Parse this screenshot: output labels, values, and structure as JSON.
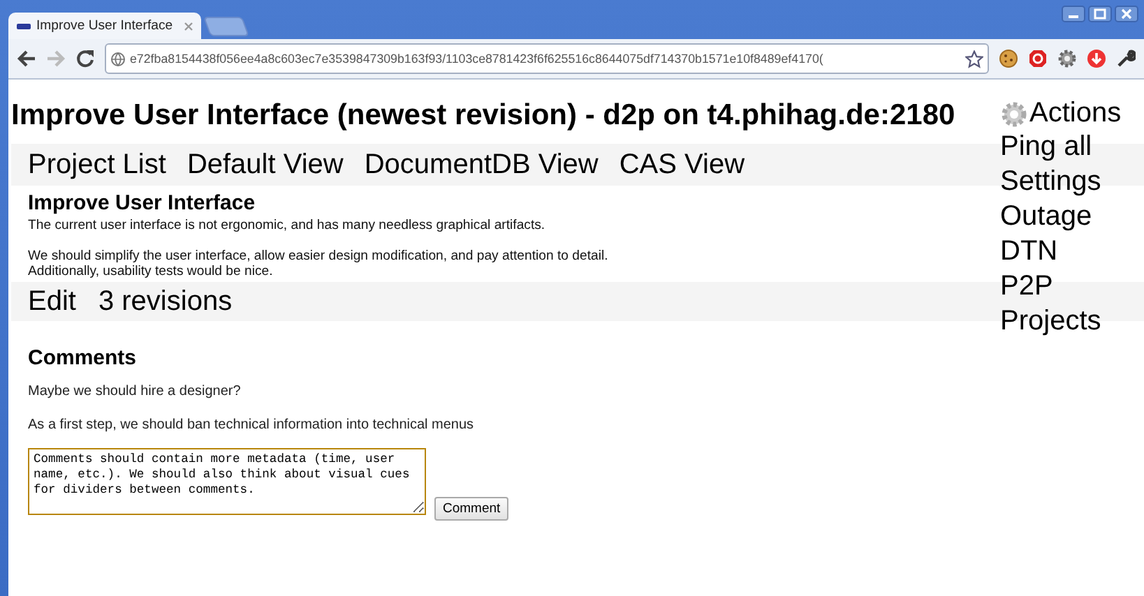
{
  "browser": {
    "tab_title": "Improve User Interface",
    "url": "e72fba8154438f056ee4a8c603ec7e3539847309b163f93/1103ce8781423f6f625516c8644075df714370b1571e10f8489ef4170("
  },
  "page": {
    "title": "Improve User Interface (newest revision) - d2p on t4.phihag.de:2180",
    "actions_label": "Actions",
    "menu": [
      "Ping all",
      "Settings",
      "Outage",
      "DTN",
      "P2P",
      "Projects"
    ],
    "nav": [
      "Project List",
      "Default View",
      "DocumentDB View",
      "CAS View"
    ],
    "document": {
      "title": "Improve User Interface",
      "paragraphs": [
        "The current user interface is not ergonomic, and has many needless graphical artifacts.",
        "We should simplify the user interface, allow easier design modification, and pay attention to detail.\nAdditionally, usability tests would be nice."
      ]
    },
    "document_links": [
      "Edit",
      "3 revisions"
    ],
    "comments_heading": "Comments",
    "comments": [
      "Maybe we should hire a designer?",
      "As a first step, we should ban technical information into technical menus"
    ],
    "comment_field": {
      "value": "Comments should contain more metadata (time, user name, etc.). We should also think about visual cues for dividers between comments."
    },
    "comment_button": "Comment"
  }
}
